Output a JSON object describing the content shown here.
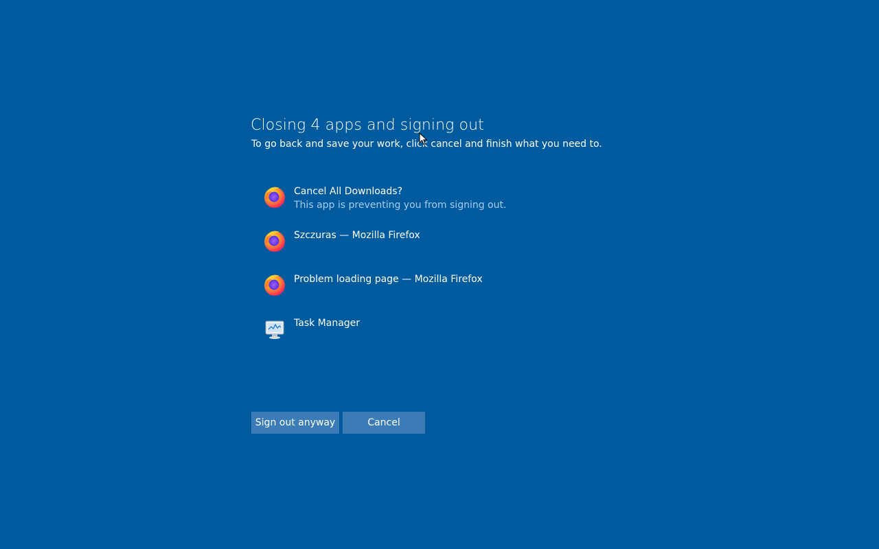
{
  "dialog": {
    "title": "Closing 4 apps and signing out",
    "subtitle": "To go back and save your work, click cancel and finish what you need to."
  },
  "apps": [
    {
      "name": "Cancel All Downloads?",
      "note": "This app is preventing you from signing out.",
      "icon": "firefox-icon"
    },
    {
      "name": "Szczuras — Mozilla Firefox",
      "note": "",
      "icon": "firefox-icon"
    },
    {
      "name": "Problem loading page — Mozilla Firefox",
      "note": "",
      "icon": "firefox-icon"
    },
    {
      "name": "Task Manager",
      "note": "",
      "icon": "task-manager-icon"
    }
  ],
  "buttons": {
    "sign_out_label": "Sign out anyway",
    "cancel_label": "Cancel"
  },
  "colors": {
    "background": "#005a9e",
    "button": "#3c7cb6",
    "note_text": "#a9cdf2"
  }
}
